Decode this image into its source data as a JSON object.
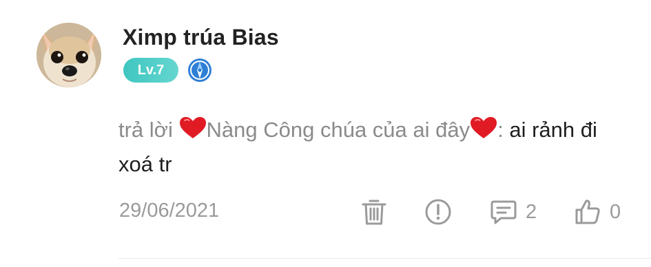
{
  "comment": {
    "author": "Ximp trúa Bias",
    "level": "Lv.7",
    "reply_prefix": "trả lời ",
    "reply_target": "Nàng Công chúa của ai đây",
    "reply_colon": ": ",
    "message": "ai rảnh đi xoá tr",
    "date": "29/06/2021",
    "reply_count": "2",
    "like_count": "0"
  },
  "icons": {
    "avatar": "chihuahua-avatar",
    "rank": "compass-rank-icon",
    "heart": "red-heart-emoji",
    "delete": "trash-icon",
    "report": "exclamation-icon",
    "reply": "comment-icon",
    "like": "thumbs-up-icon"
  },
  "colors": {
    "level_badge": "#4ecdc4",
    "rank_icon": "#2f7fd6",
    "heart": "#e01b24",
    "muted_text": "#9a9a9a"
  }
}
